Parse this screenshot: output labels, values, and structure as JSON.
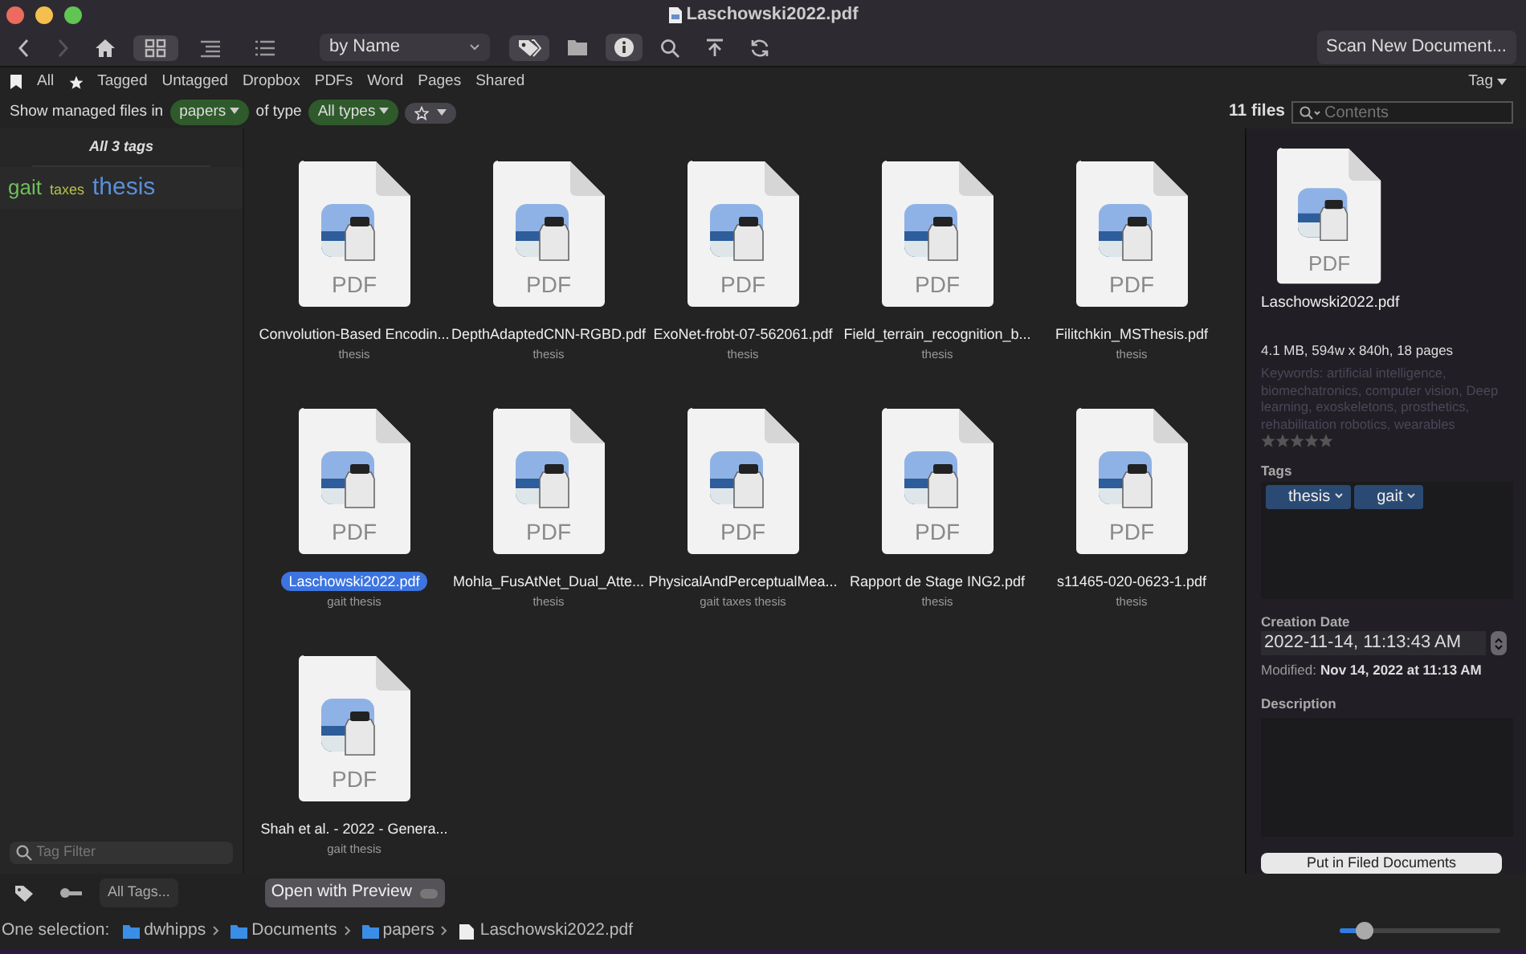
{
  "window": {
    "title": "Laschowski2022.pdf"
  },
  "toolbar": {
    "views": [
      {
        "kind": "grid",
        "selected": true
      },
      {
        "kind": "columns",
        "selected": false
      },
      {
        "kind": "list",
        "selected": false
      }
    ],
    "sort": "by Name",
    "tags_active": true,
    "info_active": true,
    "scan_button": "Scan New Document..."
  },
  "filters": [
    {
      "kind": "icon-bookmark"
    },
    {
      "kind": "text",
      "label": "All"
    },
    {
      "kind": "icon-star"
    },
    {
      "kind": "text",
      "label": "Tagged"
    },
    {
      "kind": "text",
      "label": "Untagged"
    },
    {
      "kind": "text",
      "label": "Dropbox"
    },
    {
      "kind": "text",
      "label": "PDFs"
    },
    {
      "kind": "text",
      "label": "Word"
    },
    {
      "kind": "text",
      "label": "Pages"
    },
    {
      "kind": "text",
      "label": "Shared"
    }
  ],
  "tag_menu": "Tag",
  "options": {
    "prefix": "Show managed files in",
    "folder": "papers",
    "middle": "of type",
    "type": "All types",
    "file_count": "11 files",
    "search_placeholder": "Contents"
  },
  "sidebar": {
    "heading": "All 3 tags",
    "tags": [
      {
        "label": "gait",
        "color": "#6fbf5a",
        "kind": "medium"
      },
      {
        "label": "taxes",
        "color": "#b5c04a",
        "kind": "small"
      },
      {
        "label": "thesis",
        "color": "#5a8fd8",
        "kind": "large"
      }
    ],
    "filter_placeholder": "Tag Filter",
    "all_tags_button": "All Tags..."
  },
  "files": [
    {
      "name": "Convolution-Based Encodin...",
      "tags": "thesis",
      "type": "PDF",
      "selected": false
    },
    {
      "name": "DepthAdaptedCNN-RGBD.pdf",
      "tags": "thesis",
      "type": "PDF",
      "selected": false
    },
    {
      "name": "ExoNet-frobt-07-562061.pdf",
      "tags": "thesis",
      "type": "PDF",
      "selected": false
    },
    {
      "name": "Field_terrain_recognition_b...",
      "tags": "thesis",
      "type": "PDF",
      "selected": false
    },
    {
      "name": "Filitchkin_MSThesis.pdf",
      "tags": "thesis",
      "type": "PDF",
      "selected": false
    },
    {
      "name": "Laschowski2022.pdf",
      "tags": "gait thesis",
      "type": "PDF",
      "selected": true
    },
    {
      "name": "Mohla_FusAtNet_Dual_Atte...",
      "tags": "thesis",
      "type": "PDF",
      "selected": false
    },
    {
      "name": "PhysicalAndPerceptualMea...",
      "tags": "gait taxes thesis",
      "type": "PDF",
      "selected": false
    },
    {
      "name": "Rapport de Stage ING2.pdf",
      "tags": "thesis",
      "type": "PDF",
      "selected": false
    },
    {
      "name": "s11465-020-0623-1.pdf",
      "tags": "thesis",
      "type": "PDF",
      "selected": false
    },
    {
      "name": "Shah et al. - 2022 - Genera...",
      "tags": "gait thesis",
      "type": "PDF",
      "selected": false
    }
  ],
  "open_button": "Open with Preview",
  "inspector": {
    "type": "PDF",
    "name": "Laschowski2022.pdf",
    "info": "4.1 MB, 594w x 840h, 18 pages",
    "keywords": "Keywords: artificial intelligence, biomechatronics, computer vision, Deep learning, exoskeletons, prosthetics, rehabilitation robotics, wearables",
    "stars": 0,
    "tags_label": "Tags",
    "tags": [
      "thesis",
      "gait"
    ],
    "creation_label": "Creation Date",
    "creation_date": "2022-11-14, 11:13:43 AM",
    "modified_label": "Modified:",
    "modified": "Nov 14, 2022 at 11:13 AM",
    "description_label": "Description",
    "file_button": "Put in Filed Documents"
  },
  "path": {
    "label": "One selection:",
    "items": [
      {
        "kind": "home",
        "label": "dwhipps"
      },
      {
        "kind": "folder",
        "label": "Documents"
      },
      {
        "kind": "folder",
        "label": "papers"
      },
      {
        "kind": "file",
        "label": "Laschowski2022.pdf"
      }
    ]
  },
  "zoom_slider": {
    "level": 0.15
  }
}
